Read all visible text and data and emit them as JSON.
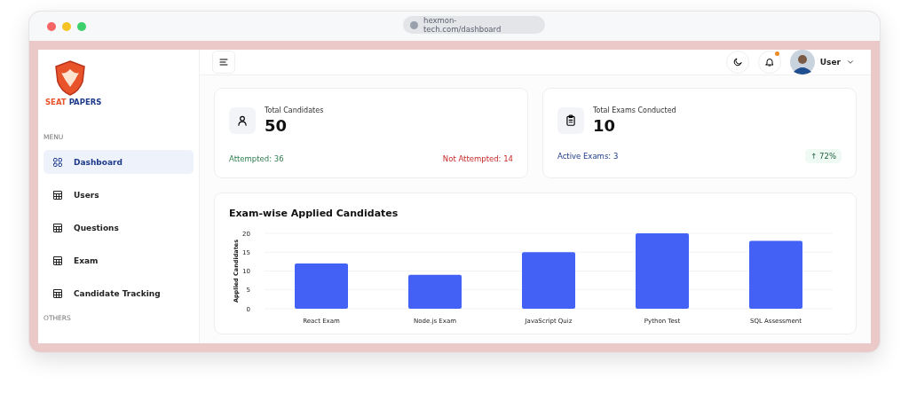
{
  "browser": {
    "url": "hexmon-tech.com/dashboard"
  },
  "logo": {
    "words": [
      "SEAT",
      "PAPERS"
    ]
  },
  "sidebar": {
    "sections": [
      {
        "title": "MENU",
        "items": [
          {
            "label": "Dashboard",
            "kind": "grid",
            "selected": true
          },
          {
            "label": "Users",
            "kind": "table",
            "selected": false
          },
          {
            "label": "Questions",
            "kind": "table",
            "selected": false
          },
          {
            "label": "Exam",
            "kind": "table",
            "selected": false
          },
          {
            "label": "Candidate Tracking",
            "kind": "table",
            "selected": false
          }
        ]
      },
      {
        "title": "OTHERS"
      }
    ]
  },
  "header": {
    "notification_unread": true,
    "user": "User"
  },
  "stats": [
    {
      "kind": "person",
      "title": "Total Candidates",
      "value": "50",
      "details": [
        {
          "text": "Attempted: 36",
          "kind": "success"
        },
        {
          "text": "Not Attempted: 14",
          "kind": "danger"
        }
      ]
    },
    {
      "kind": "clipboard",
      "title": "Total Exams Conducted",
      "value": "10",
      "details": [
        {
          "text": "Active Exams: 3",
          "kind": "info"
        },
        {
          "text": "↑ 72%",
          "kind": "trend"
        }
      ]
    }
  ],
  "chart_card": {
    "title": "Exam-wise Applied Candidates",
    "chart_data": {
      "type": "bar",
      "ylabel": "Applied Candidates",
      "categories": [
        "React Exam",
        "Node.js Exam",
        "JavaScript Quiz",
        "Python Test",
        "SQL Assessment"
      ],
      "values": [
        12,
        9,
        15,
        20,
        18
      ],
      "ylim": [
        0,
        20
      ],
      "yticks": [
        0,
        5,
        10,
        15,
        20
      ],
      "grid": true
    }
  }
}
